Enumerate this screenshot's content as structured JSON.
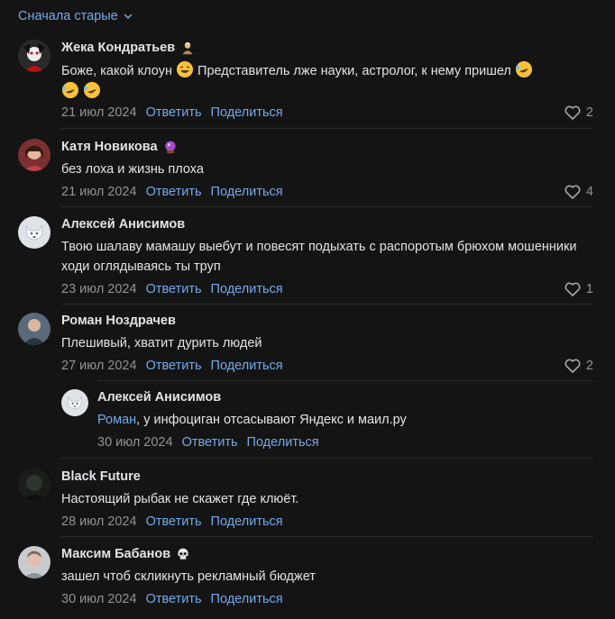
{
  "sort_label": "Сначала старые",
  "c1": {
    "author": "Жека Кондратьев",
    "text": "Боже, какой клоун",
    "text2": "Представитель лже науки, астролог, к нему пришел",
    "date": "21 июл 2024",
    "reply": "Ответить",
    "share": "Поделиться",
    "likes": "2"
  },
  "c2": {
    "author": "Катя Новикова",
    "text": "без лоха и жизнь плоха",
    "date": "21 июл 2024",
    "reply": "Ответить",
    "share": "Поделиться",
    "likes": "4"
  },
  "c3": {
    "author": "Алексей Анисимов",
    "text": "Твою шалаву мамашу выебут и повесят подыхать с распоротым брюхом мошенники ходи оглядываясь ты труп",
    "date": "23 июл 2024",
    "reply": "Ответить",
    "share": "Поделиться",
    "likes": "1"
  },
  "c4": {
    "author": "Роман Ноздрачев",
    "text": "Плешивый, хватит дурить людей",
    "date": "27 июл 2024",
    "reply": "Ответить",
    "share": "Поделиться",
    "likes": "2"
  },
  "r1": {
    "author": "Алексей Анисимов",
    "mention": "Роман",
    "text": ", у инфоциган отсасывают Яндекс и маил.ру",
    "date": "30 июл 2024",
    "reply": "Ответить",
    "share": "Поделиться"
  },
  "c5": {
    "author": "Black Future",
    "text": "Настоящий рыбак не скажет где клюёт.",
    "date": "28 июл 2024",
    "reply": "Ответить",
    "share": "Поделиться"
  },
  "c6": {
    "author": "Максим Бабанов",
    "text": "зашел чтоб скликнуть рекламный бюджет",
    "date": "30 июл 2024",
    "reply": "Ответить",
    "share": "Поделиться"
  }
}
